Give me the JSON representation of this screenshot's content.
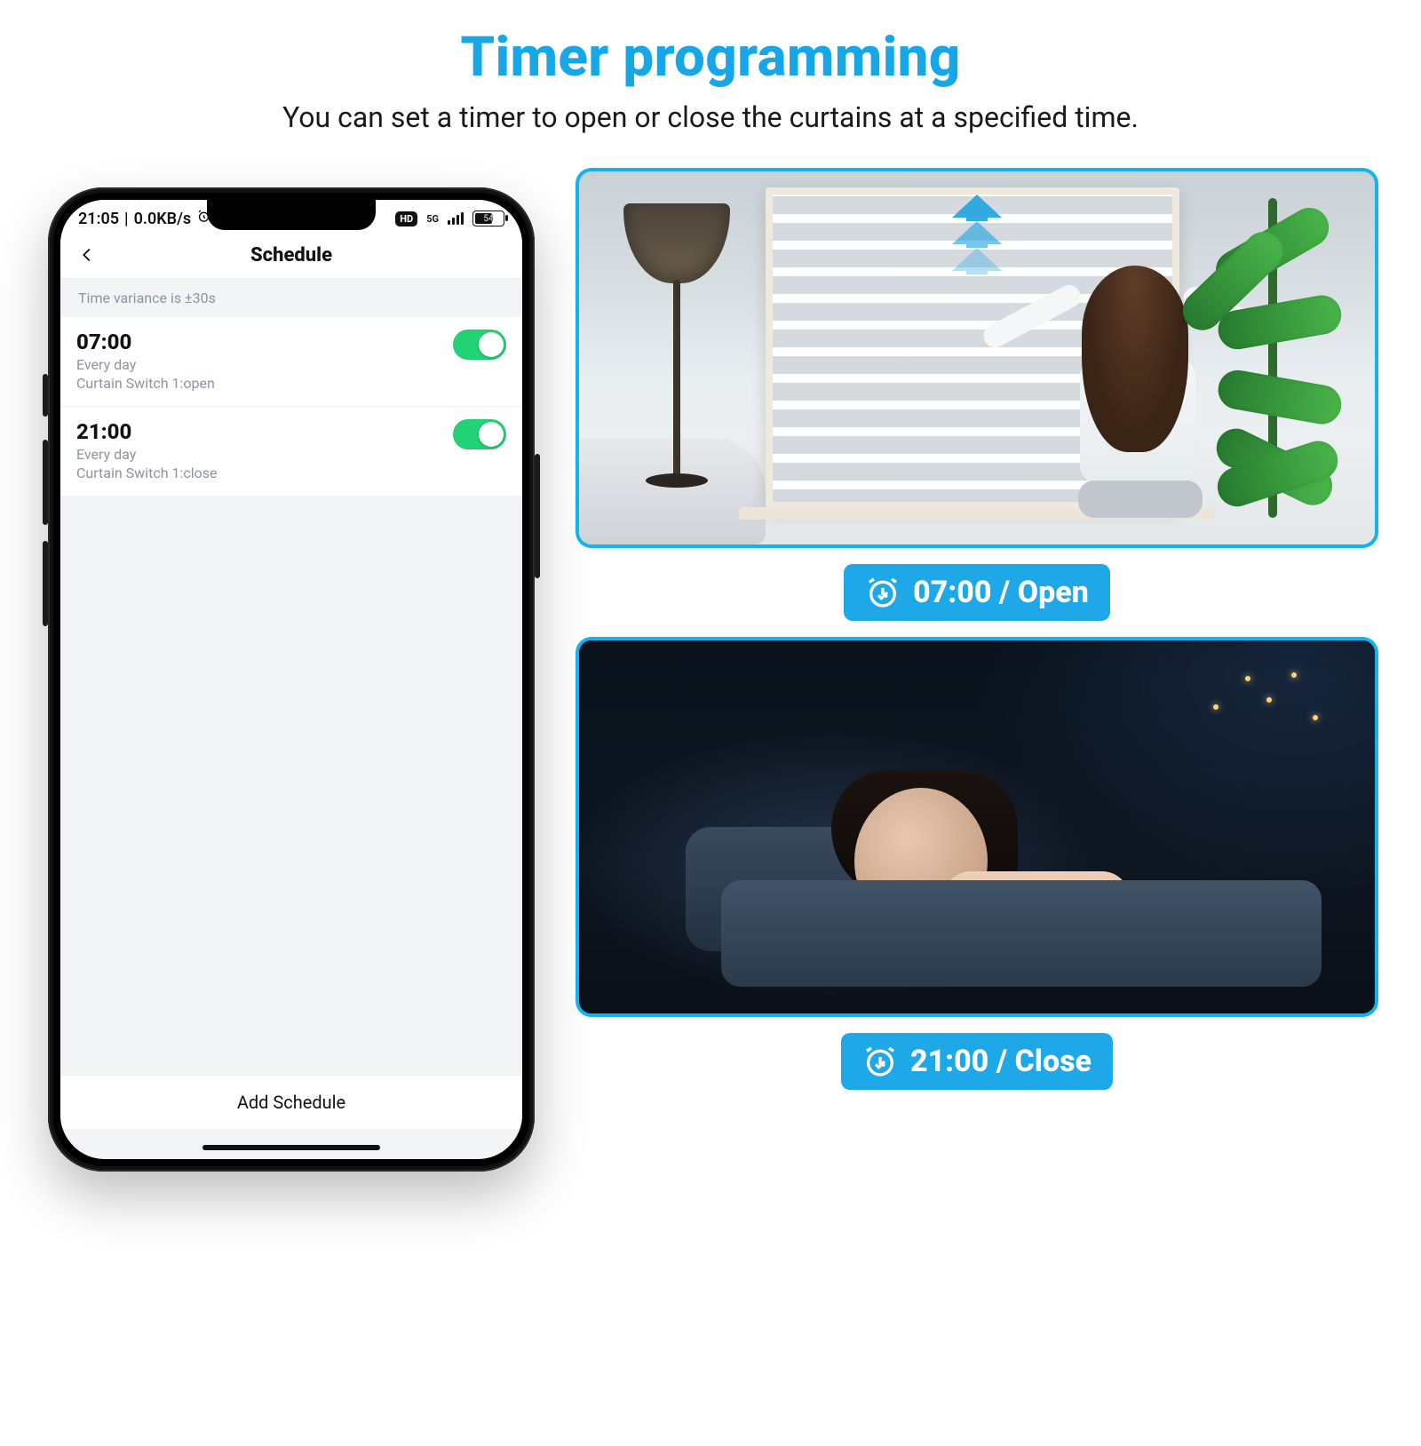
{
  "hero": {
    "title": "Timer programming",
    "subtitle": "You can set a timer to open or close the curtains at a specified time."
  },
  "phone": {
    "statusbar": {
      "time": "21:05",
      "speed": "0.0KB/s",
      "hd_badge": "HD",
      "signal_label": "5G",
      "battery_percent": "54"
    },
    "appbar": {
      "title": "Schedule"
    },
    "notice": "Time variance is ±30s",
    "schedules": [
      {
        "time": "07:00",
        "repeat": "Every day",
        "action": "Curtain Switch 1:open",
        "enabled": true
      },
      {
        "time": "21:00",
        "repeat": "Every day",
        "action": "Curtain Switch 1:close",
        "enabled": true
      }
    ],
    "add_button": "Add Schedule"
  },
  "scenes": {
    "open": {
      "label": "07:00 / Open"
    },
    "close": {
      "label": "21:00 / Close"
    }
  },
  "colors": {
    "brand": "#18a7e6",
    "toggle_on": "#22d376",
    "scene_border": "#12b4ef"
  }
}
